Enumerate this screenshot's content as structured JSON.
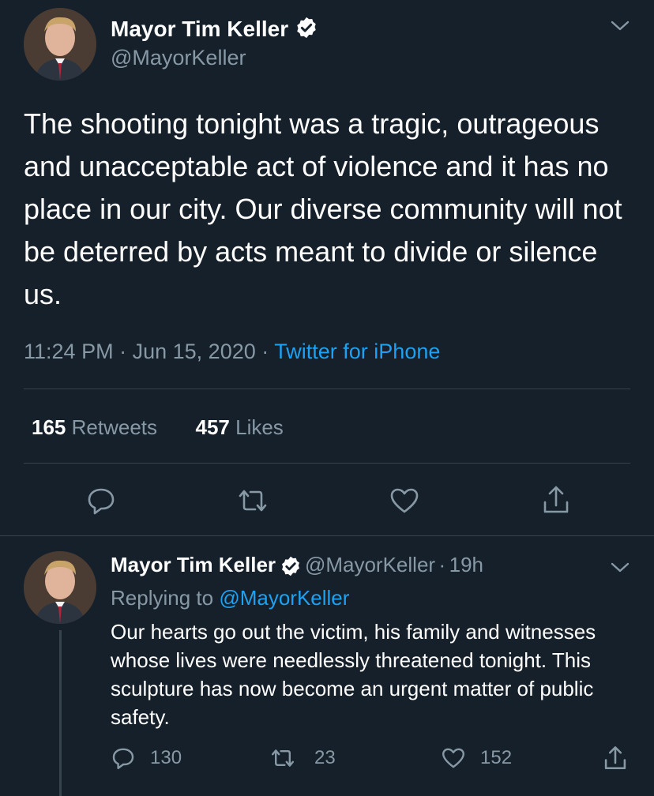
{
  "colors": {
    "background": "#15202b",
    "text_primary": "#ffffff",
    "text_secondary": "#8899a6",
    "link": "#1da1f2",
    "divider": "#38444d"
  },
  "main_tweet": {
    "author_name": "Mayor Tim Keller",
    "author_handle": "@MayorKeller",
    "verified_icon": "verified-badge-icon",
    "text": "The shooting tonight was a tragic, outrageous and unacceptable act of violence and it has no place in our city. Our diverse community will not be deterred by acts meant to divide or silence us.",
    "time": "11:24 PM",
    "separator": "·",
    "date": "Jun 15, 2020",
    "source": "Twitter for iPhone",
    "retweets_count": "165",
    "retweets_label": "Retweets",
    "likes_count": "457",
    "likes_label": "Likes",
    "actions": [
      "reply-icon",
      "retweet-icon",
      "like-icon",
      "share-icon"
    ]
  },
  "reply_tweet": {
    "author_name": "Mayor Tim Keller",
    "author_handle": "@MayorKeller",
    "separator": "·",
    "age": "19h",
    "replying_prefix": "Replying to",
    "replying_to": "@MayorKeller",
    "text": "Our hearts go out the victim, his family and witnesses whose lives were needlessly threatened tonight. This sculpture has now become an urgent matter of public safety.",
    "reply_count": "130",
    "retweet_count": "23",
    "like_count": "152"
  }
}
